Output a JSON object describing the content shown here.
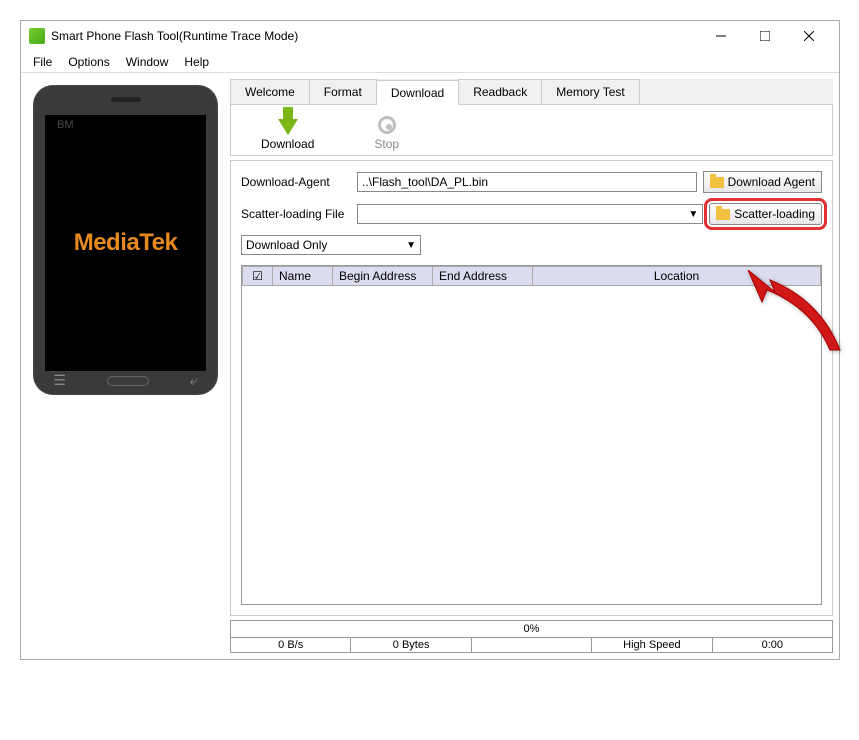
{
  "window": {
    "title": "Smart Phone Flash Tool(Runtime Trace Mode)"
  },
  "menu": {
    "file": "File",
    "options": "Options",
    "window": "Window",
    "help": "Help"
  },
  "phone": {
    "brand": "MediaTek",
    "model": "BM"
  },
  "tabs": {
    "welcome": "Welcome",
    "format": "Format",
    "download": "Download",
    "readback": "Readback",
    "memtest": "Memory Test"
  },
  "toolbar": {
    "download": "Download",
    "stop": "Stop"
  },
  "labels": {
    "download_agent": "Download-Agent",
    "scatter_file": "Scatter-loading File"
  },
  "inputs": {
    "download_agent_value": "..\\Flash_tool\\DA_PL.bin",
    "scatter_file_value": ""
  },
  "buttons": {
    "download_agent": "Download Agent",
    "scatter_loading": "Scatter-loading"
  },
  "dropdown": {
    "mode": "Download Only"
  },
  "table": {
    "col_check": "☑",
    "col_name": "Name",
    "col_begin": "Begin Address",
    "col_end": "End Address",
    "col_location": "Location"
  },
  "status": {
    "progress": "0%",
    "rate": "0 B/s",
    "bytes": "0 Bytes",
    "speed_label": "High Speed",
    "elapsed": "0:00"
  }
}
